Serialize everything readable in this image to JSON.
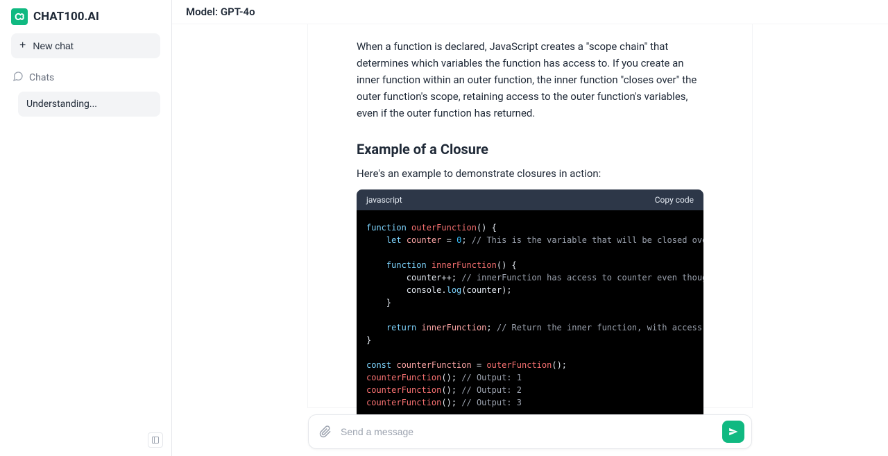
{
  "sidebar": {
    "brand": "CHAT100.AI",
    "new_chat": "New chat",
    "chats_label": "Chats",
    "items": [
      {
        "title": "Understanding..."
      }
    ]
  },
  "header": {
    "model_prefix": "Model: ",
    "model_name": "GPT-4o"
  },
  "message": {
    "para1": "When a function is declared, JavaScript creates a \"scope chain\" that determines which variables the function has access to. If you create an inner function within an outer function, the inner function \"closes over\" the outer function's scope, retaining access to the outer function's variables, even if the outer function has returned.",
    "heading": "Example of a Closure",
    "para2": "Here's an example to demonstrate closures in action:",
    "code": {
      "language": "javascript",
      "copy_label": "Copy code",
      "lines": [
        [
          {
            "t": "function ",
            "c": "kw"
          },
          {
            "t": "outerFunction",
            "c": "fn"
          },
          {
            "t": "() {"
          }
        ],
        [
          {
            "t": "    "
          },
          {
            "t": "let ",
            "c": "kw"
          },
          {
            "t": "counter",
            "c": "var"
          },
          {
            "t": " = "
          },
          {
            "t": "0",
            "c": "num"
          },
          {
            "t": "; "
          },
          {
            "t": "// This is the variable that will be closed over",
            "c": "cmt"
          }
        ],
        [
          {
            "t": ""
          }
        ],
        [
          {
            "t": "    "
          },
          {
            "t": "function ",
            "c": "kw"
          },
          {
            "t": "innerFunction",
            "c": "fn"
          },
          {
            "t": "() {"
          }
        ],
        [
          {
            "t": "        counter++; "
          },
          {
            "t": "// innerFunction has access to counter even though it's declared in o",
            "c": "cmt"
          }
        ],
        [
          {
            "t": "        "
          },
          {
            "t": "console",
            "c": ""
          },
          {
            "t": ".",
            "c": ""
          },
          {
            "t": "log",
            "c": "prop"
          },
          {
            "t": "(counter);"
          }
        ],
        [
          {
            "t": "    }"
          }
        ],
        [
          {
            "t": ""
          }
        ],
        [
          {
            "t": "    "
          },
          {
            "t": "return ",
            "c": "kw"
          },
          {
            "t": "innerFunction",
            "c": "var"
          },
          {
            "t": "; "
          },
          {
            "t": "// Return the inner function, with access to outerFunction's s",
            "c": "cmt"
          }
        ],
        [
          {
            "t": "}"
          }
        ],
        [
          {
            "t": ""
          }
        ],
        [
          {
            "t": "const ",
            "c": "kw"
          },
          {
            "t": "counterFunction",
            "c": "var"
          },
          {
            "t": " = "
          },
          {
            "t": "outerFunction",
            "c": "fn"
          },
          {
            "t": "();"
          }
        ],
        [
          {
            "t": "counterFunction",
            "c": "fn"
          },
          {
            "t": "(); "
          },
          {
            "t": "// Output: 1",
            "c": "cmt"
          }
        ],
        [
          {
            "t": "counterFunction",
            "c": "fn"
          },
          {
            "t": "(); "
          },
          {
            "t": "// Output: 2",
            "c": "cmt"
          }
        ],
        [
          {
            "t": "counterFunction",
            "c": "fn"
          },
          {
            "t": "(); "
          },
          {
            "t": "// Output: 3",
            "c": "cmt"
          }
        ]
      ]
    }
  },
  "input": {
    "placeholder": "Send a message"
  }
}
